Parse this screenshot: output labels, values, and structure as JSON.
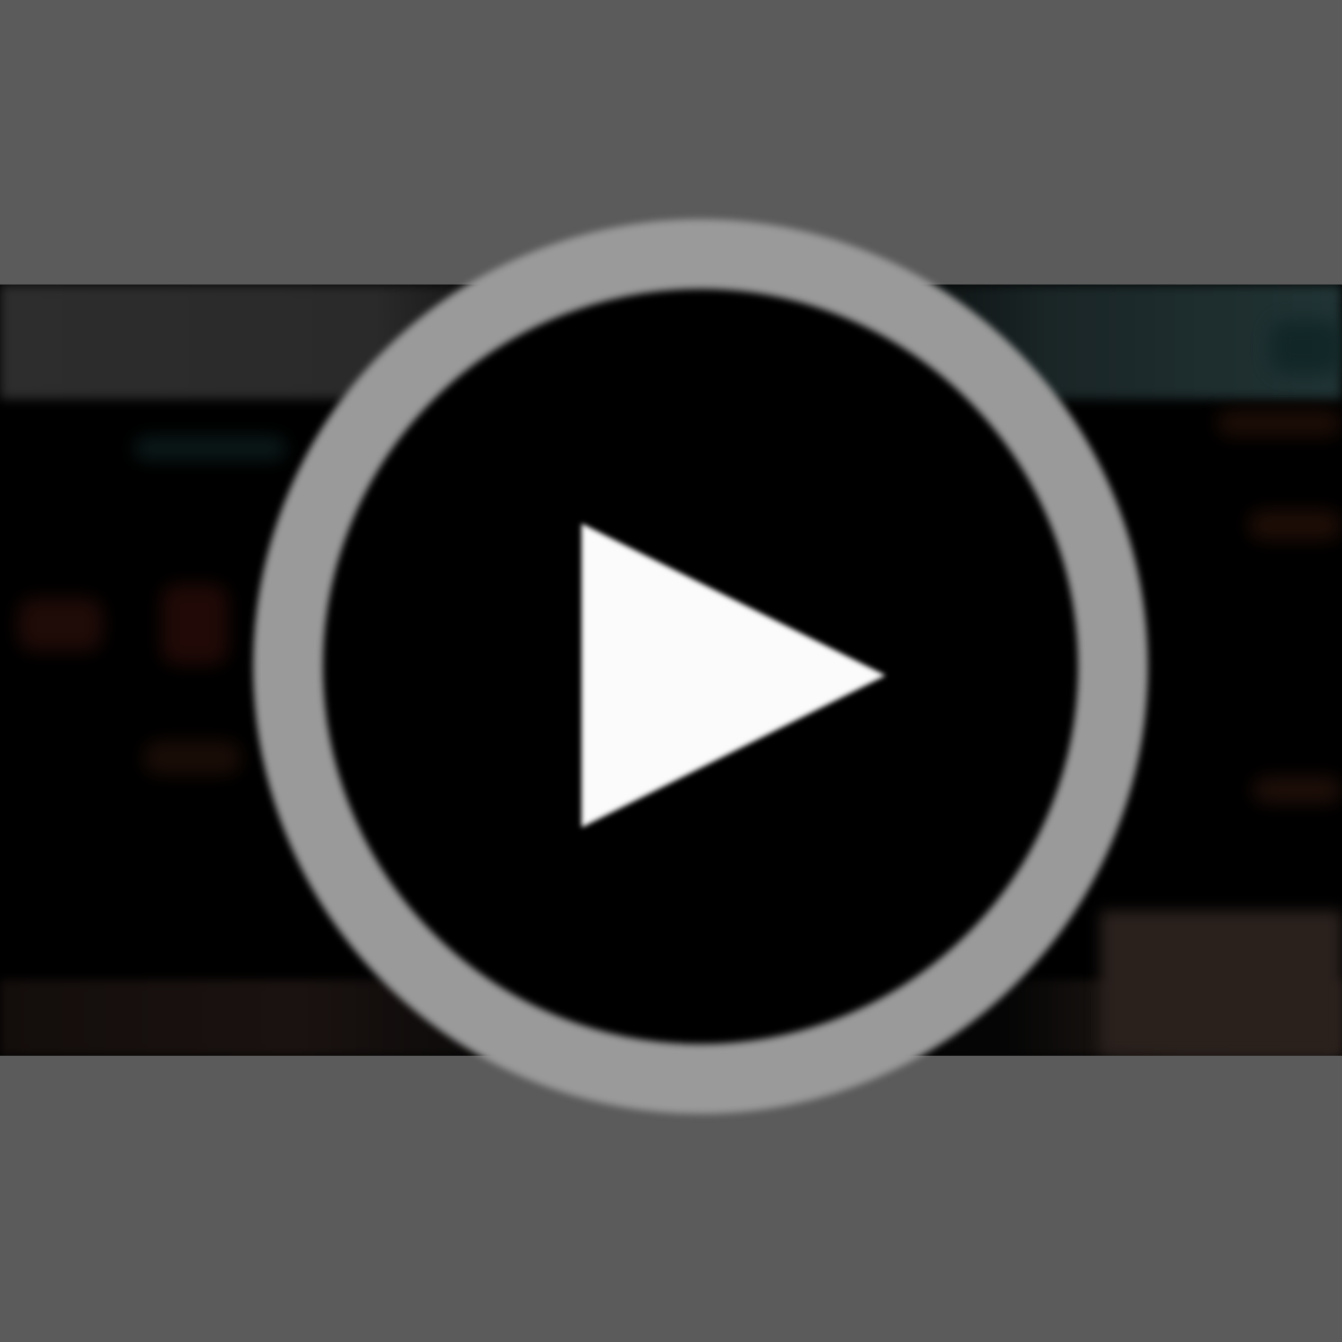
{
  "video": {
    "play_icon": "play-icon"
  },
  "colors": {
    "background": "#5b5b5b",
    "thumbnail": "#000000",
    "ring": "#9a9a9a",
    "triangle": "#fbfbfb"
  }
}
